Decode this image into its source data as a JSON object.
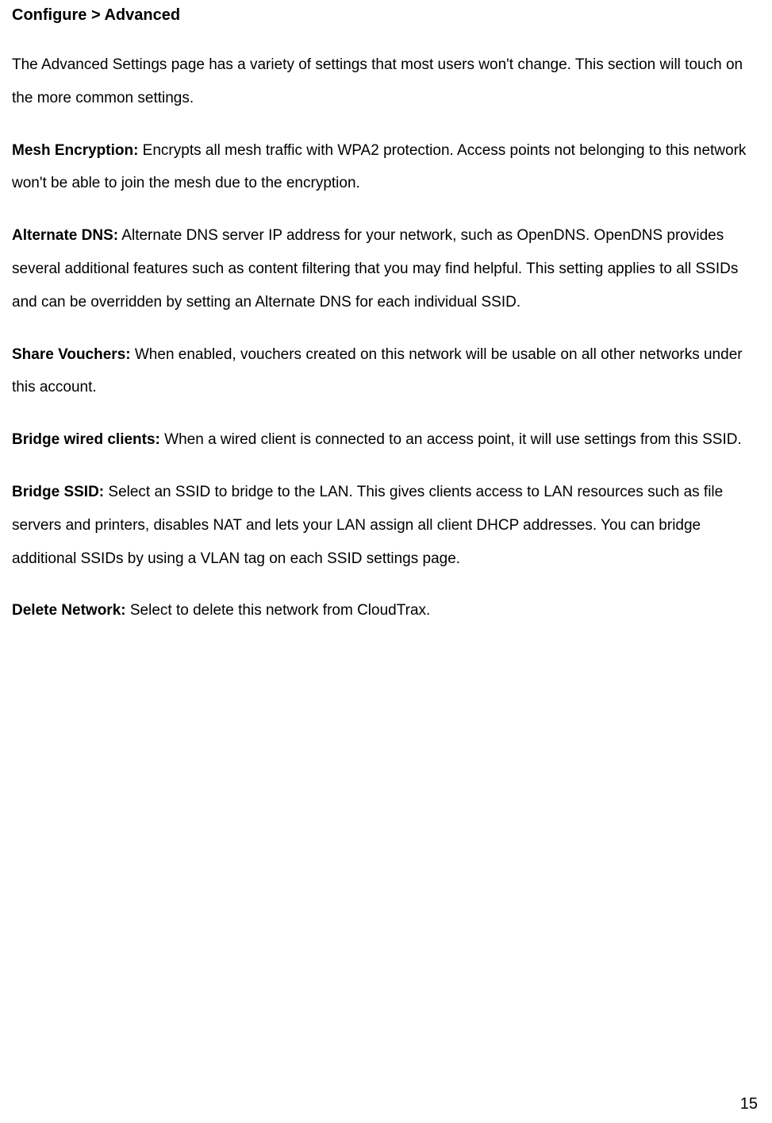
{
  "heading": "Configure > Advanced",
  "intro": "The Advanced Settings page has a variety of settings that most users won't change. This section will touch on the more common settings.",
  "items": [
    {
      "label": "Mesh Encryption:",
      "text": " Encrypts all mesh traffic with WPA2 protection. Access points not belonging to this network won't be able to join the mesh due to the encryption."
    },
    {
      "label": "Alternate DNS:",
      "text": " Alternate DNS server IP address for your network, such as OpenDNS. OpenDNS provides several additional features such as content filtering that you may find helpful. This setting applies to all SSIDs and can be overridden by setting an Alternate DNS for each individual SSID."
    },
    {
      "label": "Share Vouchers:",
      "text": " When enabled, vouchers created on this network will be usable on all other networks under this account."
    },
    {
      "label": "Bridge wired clients:",
      "text": " When a wired client is connected to an access point, it will use settings from this SSID."
    },
    {
      "label": "Bridge SSID:",
      "text": " Select an SSID to bridge to the LAN. This gives clients access to LAN resources such as file servers and printers, disables NAT and lets your LAN assign all client DHCP addresses. You can bridge additional SSIDs by using a VLAN tag on each SSID settings page."
    },
    {
      "label": "Delete Network:",
      "text": " Select to delete this network from CloudTrax."
    }
  ],
  "pageNumber": "15"
}
